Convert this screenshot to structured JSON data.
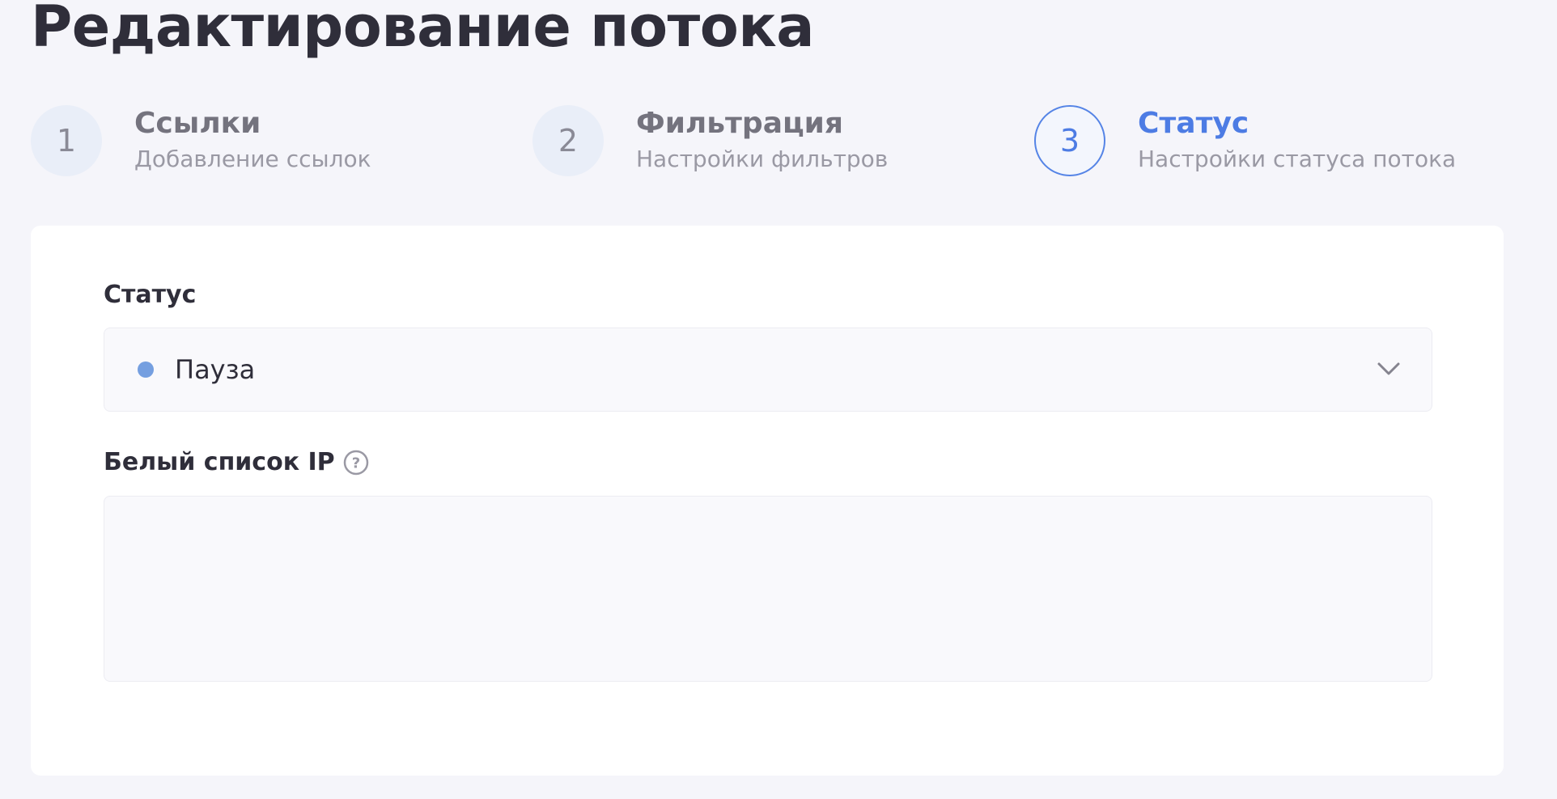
{
  "page": {
    "title": "Редактирование потока"
  },
  "steps": [
    {
      "number": "1",
      "title": "Ссылки",
      "subtitle": "Добавление ссылок",
      "active": false
    },
    {
      "number": "2",
      "title": "Фильтрация",
      "subtitle": "Настройки фильтров",
      "active": false
    },
    {
      "number": "3",
      "title": "Статус",
      "subtitle": "Настройки статуса потока",
      "active": true
    }
  ],
  "form": {
    "status_label": "Статус",
    "status_value": "Пауза",
    "status_dot_color": "#759fe0",
    "whitelist_label": "Белый список IP",
    "whitelist_value": ""
  },
  "icons": {
    "help": "question-circle-icon",
    "dropdown": "chevron-down-icon"
  },
  "colors": {
    "accent": "#4d7ce4",
    "background": "#f5f5fa",
    "card": "#ffffff"
  }
}
